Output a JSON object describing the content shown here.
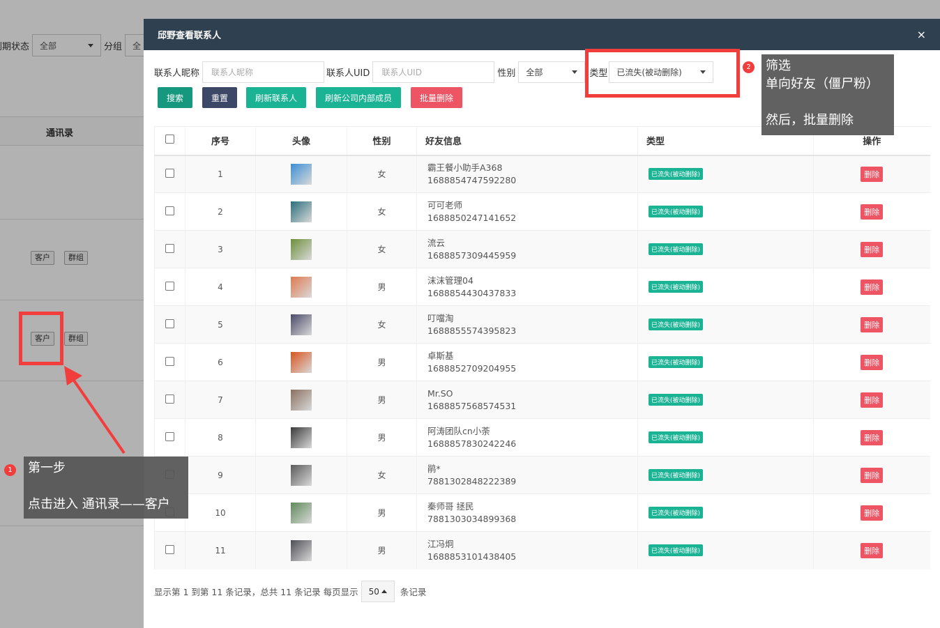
{
  "background": {
    "expiry_label": "到期状态",
    "expiry_value": "全部",
    "group_label": "分组",
    "group_value": "全",
    "column_header": "通讯录",
    "rows": [
      {
        "tag_customer": "客户",
        "tag_group": "群组"
      },
      {
        "tag_customer": "客户",
        "tag_group": "群组"
      }
    ]
  },
  "modal": {
    "title": "邱野查看联系人",
    "close_label": "×",
    "filters": {
      "nickname_label": "联系人昵称",
      "nickname_placeholder": "联系人昵称",
      "uid_label": "联系人UID",
      "uid_placeholder": "联系人UID",
      "gender_label": "性别",
      "gender_value": "全部",
      "type_label": "类型",
      "type_value": "已流失(被动删除)"
    },
    "buttons": {
      "search": "搜索",
      "reset": "重置",
      "refresh_contacts": "刷新联系人",
      "refresh_members": "刷新公司内部成员",
      "batch_delete": "批量删除"
    },
    "colors": {
      "header_bg": "#2f4050",
      "search_btn": "#16987e",
      "reset_btn": "#3d4866",
      "green_btn": "#1ab394",
      "red_btn": "#ed5565"
    },
    "table": {
      "headers": [
        "序号",
        "头像",
        "性别",
        "好友信息",
        "类型",
        "操作"
      ],
      "rows": [
        {
          "no": "1",
          "gender": "女",
          "name": "霸王餐小助手A368",
          "uid": "1688854747592280",
          "type": "已流失(被动删除)",
          "action": "删除",
          "avatar_color": "#3b8fd6"
        },
        {
          "no": "2",
          "gender": "女",
          "name": "可可老师",
          "uid": "1688850247141652",
          "type": "已流失(被动删除)",
          "action": "删除",
          "avatar_color": "#2b6f7d"
        },
        {
          "no": "3",
          "gender": "女",
          "name": "流云",
          "uid": "1688857309445959",
          "type": "已流失(被动删除)",
          "action": "删除",
          "avatar_color": "#6e8f3a"
        },
        {
          "no": "4",
          "gender": "男",
          "name": "沫沫管理04",
          "uid": "1688854430437833",
          "type": "已流失(被动删除)",
          "action": "删除",
          "avatar_color": "#e07a4f"
        },
        {
          "no": "5",
          "gender": "女",
          "name": "叮噹淘",
          "uid": "1688855574395823",
          "type": "已流失(被动删除)",
          "action": "删除",
          "avatar_color": "#4a4a6a"
        },
        {
          "no": "6",
          "gender": "男",
          "name": "卓斯基",
          "uid": "1688852709204955",
          "type": "已流失(被动删除)",
          "action": "删除",
          "avatar_color": "#d9541e"
        },
        {
          "no": "7",
          "gender": "男",
          "name": "Mr.SO",
          "uid": "1688857568574531",
          "type": "已流失(被动删除)",
          "action": "删除",
          "avatar_color": "#8b7060"
        },
        {
          "no": "8",
          "gender": "男",
          "name": "阿涛团队cn小荼",
          "uid": "1688857830242246",
          "type": "已流失(被动删除)",
          "action": "删除",
          "avatar_color": "#3a3a3a"
        },
        {
          "no": "9",
          "gender": "女",
          "name": "鹃*",
          "uid": "7881302848222389",
          "type": "已流失(被动删除)",
          "action": "删除",
          "avatar_color": "#5a5a5a"
        },
        {
          "no": "10",
          "gender": "男",
          "name": "秦师哥 拯民",
          "uid": "7881303034899368",
          "type": "已流失(被动删除)",
          "action": "删除",
          "avatar_color": "#5f8a5a"
        },
        {
          "no": "11",
          "gender": "男",
          "name": "江冯炯",
          "uid": "1688853101438405",
          "type": "已流失(被动删除)",
          "action": "删除",
          "avatar_color": "#4d4d55"
        }
      ]
    },
    "footer": {
      "summary": "显示第 1 到第 11 条记录，总共 11 条记录 每页显示",
      "page_size": "50",
      "suffix": "条记录"
    }
  },
  "annotations": {
    "step1": {
      "num": "1",
      "line1": "第一步",
      "line2": "点击进入 通讯录——客户"
    },
    "step2": {
      "num": "2",
      "line1": "筛选",
      "line2": "单向好友（僵尸粉）",
      "line3": "然后，批量删除"
    },
    "highlight_color": "#f23d3d"
  }
}
